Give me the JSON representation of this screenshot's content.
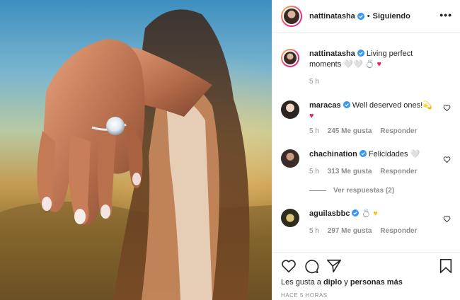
{
  "post": {
    "photo_alt": "photo",
    "header": {
      "username": "nattinatasha",
      "separator": "•",
      "follow_status": "Siguiendo",
      "more_icon": "more-horizontal-icon"
    },
    "caption": {
      "username": "nattinatasha",
      "text": "Living perfect moments",
      "emoji_tail": "🤍🤍 💍 ",
      "heart": "♥",
      "time": "5 h"
    },
    "comments": [
      {
        "username": "maracas",
        "text": "Well deserved ones!",
        "emoji": "💫",
        "heart": "♥",
        "time": "5 h",
        "likes": "245 Me gusta",
        "reply": "Responder"
      },
      {
        "username": "chachination",
        "text": "Felicidades",
        "emoji": "🤍",
        "time": "5 h",
        "likes": "313 Me gusta",
        "reply": "Responder",
        "view_replies": "Ver respuestas (2)"
      },
      {
        "username": "aguilasbbc",
        "text": "",
        "emoji": "💍",
        "heart": "♥",
        "time": "5 h",
        "likes": "297 Me gusta",
        "reply": "Responder"
      }
    ],
    "action_icons": [
      "heart-icon",
      "comment-icon",
      "share-icon",
      "bookmark-icon"
    ],
    "likes_prefix": "Les gusta a",
    "likes_user": "diplo",
    "likes_connector": "y",
    "likes_others": "personas más",
    "timestamp": "HACE 5 HORAS",
    "colors": {
      "verified": "#3897f0",
      "text": "#262626",
      "muted": "#8e8e8e",
      "heart_red": "#e0245e"
    }
  }
}
